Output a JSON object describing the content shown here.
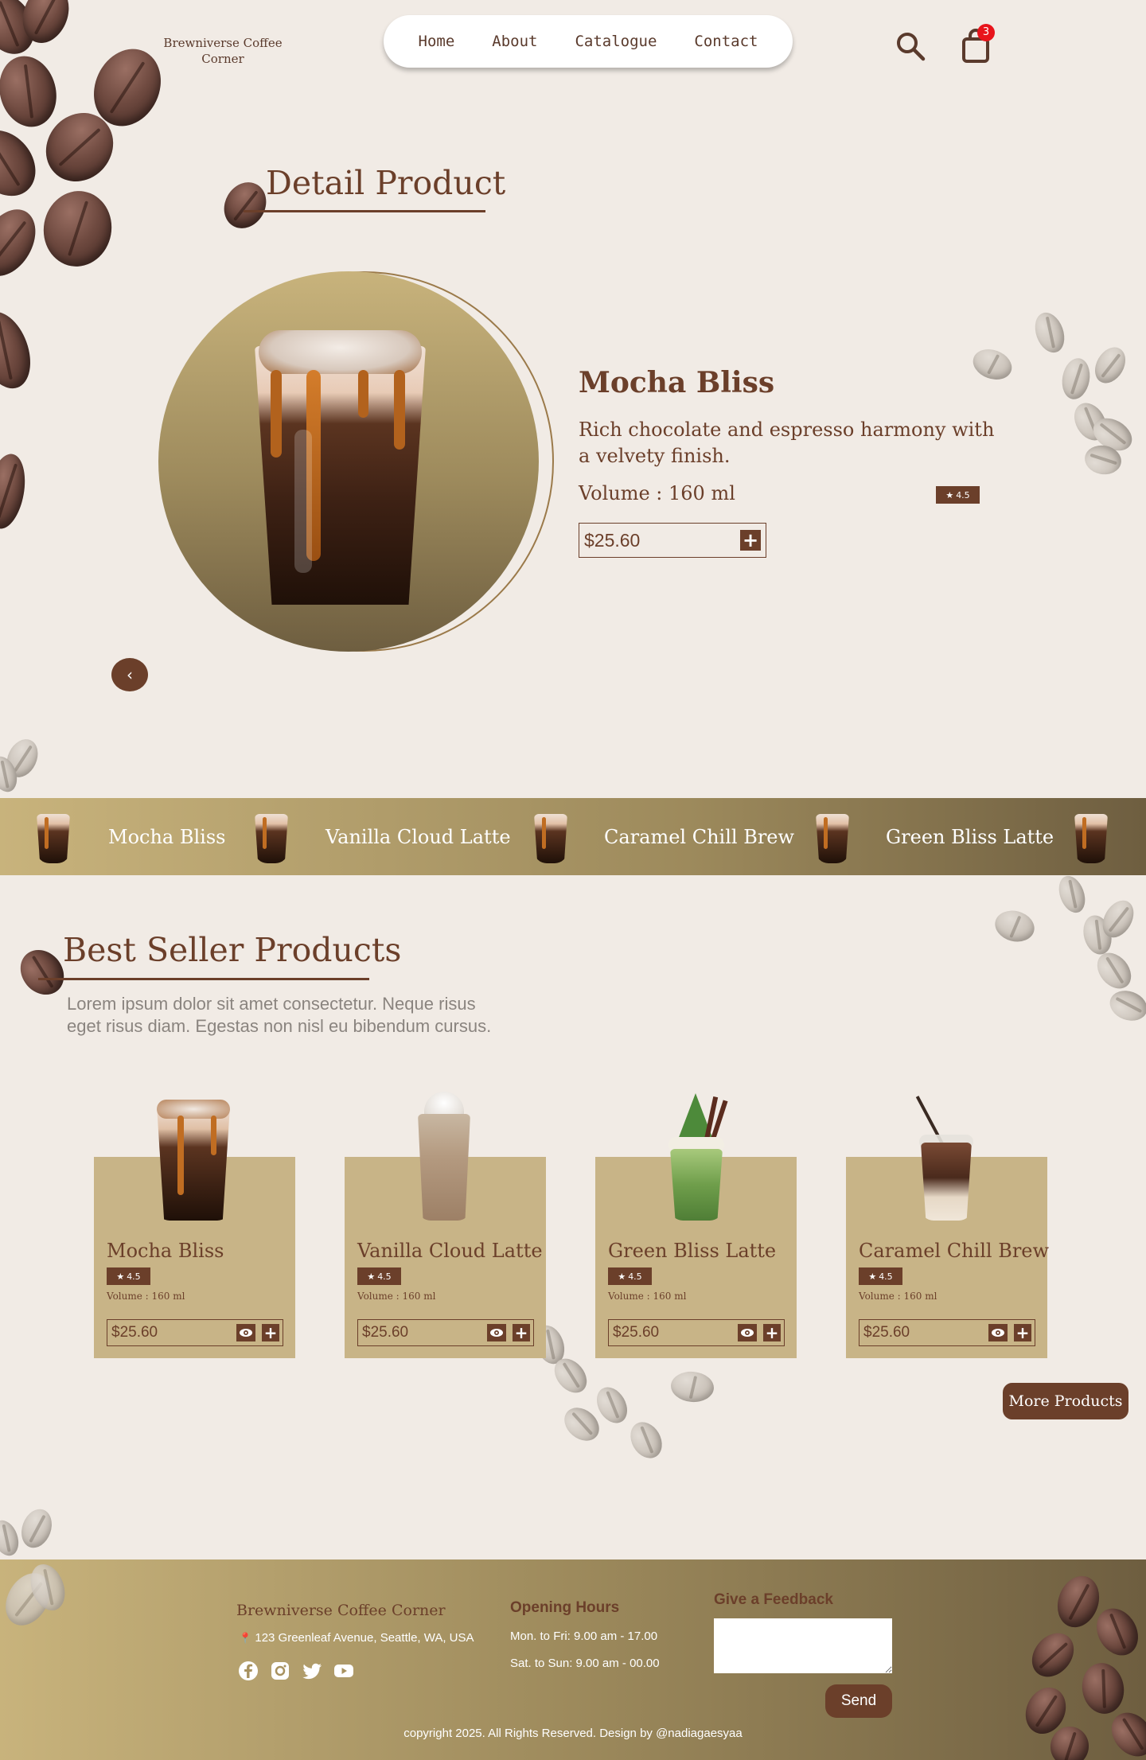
{
  "header": {
    "brand": "Brewniverse Coffee Corner",
    "nav": [
      "Home",
      "About",
      "Catalogue",
      "Contact"
    ],
    "search_icon": "search-icon",
    "cart_icon": "shopping-bag-icon",
    "cart_count": "3"
  },
  "detail": {
    "title": "Detail Product",
    "name": "Mocha Bliss",
    "description": "Rich chocolate and espresso harmony with a velvety finish.",
    "volume": "Volume : 160 ml",
    "rating": "4.5",
    "price": "$25.60",
    "prev_label": "‹"
  },
  "marquee": [
    "Mocha Bliss",
    "Vanilla Cloud Latte",
    "Caramel Chill Brew",
    "Green Bliss Latte"
  ],
  "bestseller": {
    "title": "Best Seller Products",
    "description": "Lorem ipsum dolor sit amet consectetur. Neque risus eget risus diam. Egestas non nisl eu bibendum cursus.",
    "products": [
      {
        "name": "Mocha Bliss",
        "rating": "4.5",
        "volume": "Volume : 160 ml",
        "price": "$25.60"
      },
      {
        "name": "Vanilla Cloud Latte",
        "rating": "4.5",
        "volume": "Volume : 160 ml",
        "price": "$25.60"
      },
      {
        "name": "Green Bliss Latte",
        "rating": "4.5",
        "volume": "Volume : 160 ml",
        "price": "$25.60"
      },
      {
        "name": "Caramel Chill Brew",
        "rating": "4.5",
        "volume": "Volume : 160 ml",
        "price": "$25.60"
      }
    ],
    "more_label": "More Products"
  },
  "footer": {
    "brand": "Brewniverse Coffee Corner",
    "address": "123 Greenleaf Avenue, Seattle, WA, USA",
    "hours_title": "Opening Hours",
    "hours_weekday": "Mon. to Fri: 9.00 am - 17.00",
    "hours_weekend": "Sat. to Sun: 9.00 am - 00.00",
    "feedback_title": "Give a Feedback",
    "send_label": "Send",
    "copyright": "copyright 2025. All Rights Reserved. Design by @nadiagaesyaa",
    "social_icons": [
      "facebook-icon",
      "instagram-icon",
      "twitter-icon",
      "youtube-icon"
    ]
  },
  "colors": {
    "brown": "#6b3f2a",
    "background": "#f1ebe5",
    "card": "#c8b487",
    "gold_light": "#c8b37c",
    "gold_dark": "#6e5e40",
    "badge_red": "#e8141b"
  }
}
